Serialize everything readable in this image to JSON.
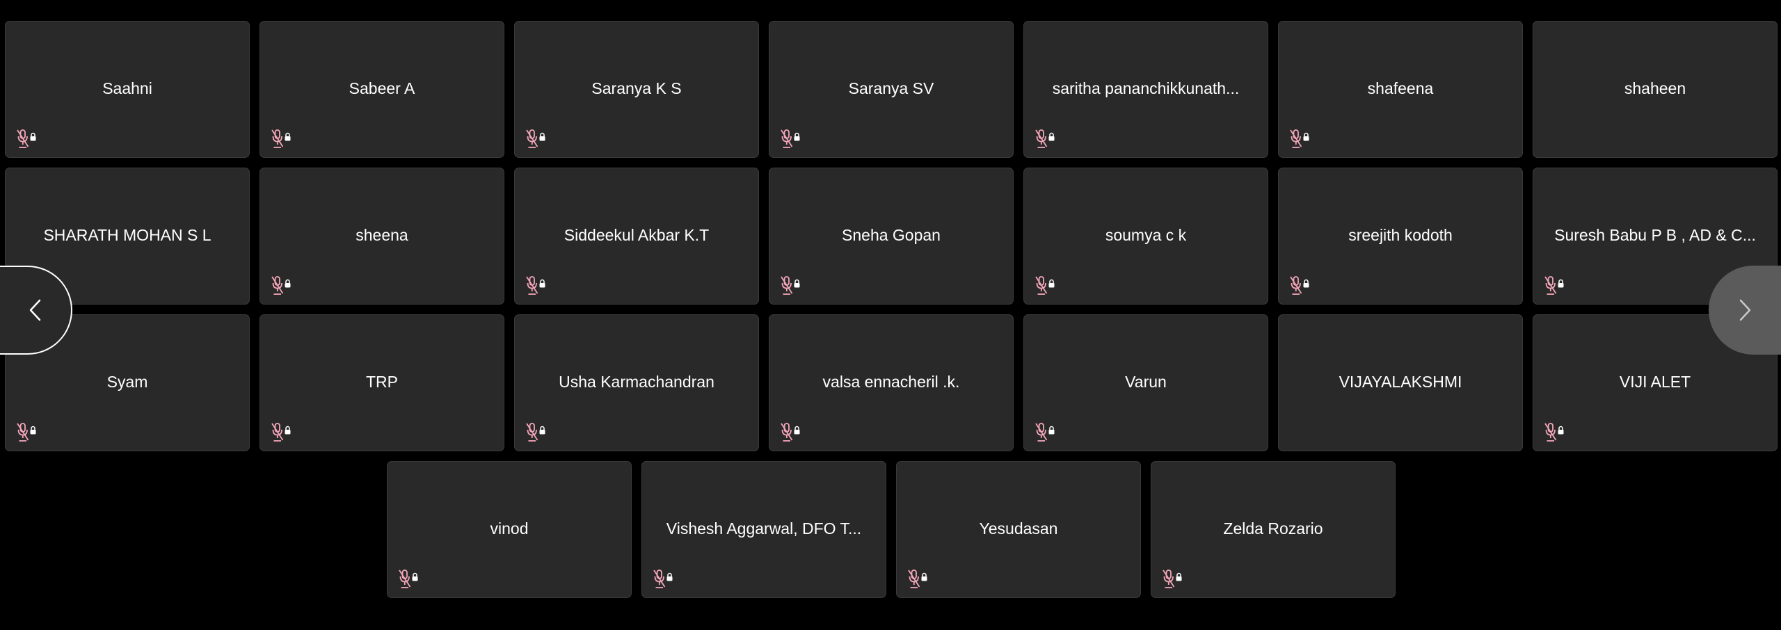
{
  "participants": [
    {
      "name": "Saahni",
      "muted": true
    },
    {
      "name": "Sabeer A",
      "muted": true
    },
    {
      "name": "Saranya K S",
      "muted": true
    },
    {
      "name": "Saranya SV",
      "muted": true
    },
    {
      "name": "saritha pananchikkunath...",
      "muted": true
    },
    {
      "name": "shafeena",
      "muted": true
    },
    {
      "name": "shaheen",
      "muted": false
    },
    {
      "name": "SHARATH MOHAN S L",
      "muted": false
    },
    {
      "name": "sheena",
      "muted": true
    },
    {
      "name": "Siddeekul Akbar K.T",
      "muted": true
    },
    {
      "name": "Sneha Gopan",
      "muted": true
    },
    {
      "name": "soumya c k",
      "muted": true
    },
    {
      "name": "sreejith kodoth",
      "muted": true
    },
    {
      "name": "Suresh Babu P B , AD & C...",
      "muted": true
    },
    {
      "name": "Syam",
      "muted": true
    },
    {
      "name": "TRP",
      "muted": true
    },
    {
      "name": "Usha Karmachandran",
      "muted": true
    },
    {
      "name": "valsa ennacheril .k.",
      "muted": true
    },
    {
      "name": "Varun",
      "muted": true
    },
    {
      "name": "VIJAYALAKSHMI",
      "muted": false
    },
    {
      "name": "VIJI ALET",
      "muted": true
    },
    {
      "name": "vinod",
      "muted": true
    },
    {
      "name": "Vishesh Aggarwal, DFO T...",
      "muted": true
    },
    {
      "name": "Yesudasan",
      "muted": true
    },
    {
      "name": "Zelda Rozario",
      "muted": true
    }
  ],
  "navigation": {
    "prev_icon": "chevron-left-icon",
    "next_icon": "chevron-right-icon"
  },
  "icons": {
    "muted_icon": "mic-off-icon"
  },
  "colors": {
    "background": "#000000",
    "tile_background": "#292929",
    "tile_border": "#3a3a3a",
    "name_text": "#ffffff",
    "muted_icon": "#f4a6b9",
    "prev_button_background": "#292929",
    "next_button_background": "#5b5b5b"
  }
}
